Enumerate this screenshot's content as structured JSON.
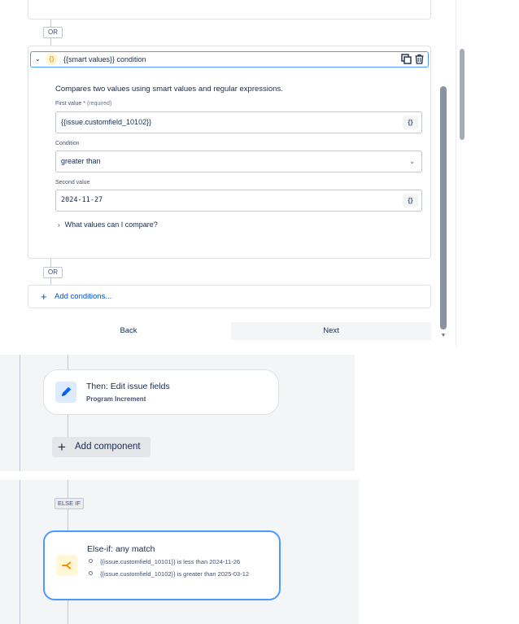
{
  "condition_panel": {
    "or_label": "OR",
    "condition": {
      "title": "{{smart values}} condition",
      "smart_icon": "{}",
      "description": "Compares two values using smart values and regular expressions.",
      "first_value": {
        "label": "First value",
        "required_marker": "*",
        "required_text": "(required)",
        "value": "{{issue.customfield_10102}}",
        "brace_button": "{}"
      },
      "condition_field": {
        "label": "Condition",
        "value": "greater than"
      },
      "second_value": {
        "label": "Second value",
        "value": "2024-11-27",
        "brace_button": "{}"
      },
      "expand_link": "What values can I compare?"
    },
    "add_conditions": "Add conditions...",
    "back": "Back",
    "next": "Next"
  },
  "then_panel": {
    "card_title": "Then: Edit issue fields",
    "card_subtitle": "Program Increment",
    "add_component": "Add component"
  },
  "else_panel": {
    "badge": "ELSE IF",
    "card_title": "Else-if: any match",
    "conditions": [
      "{{issue.customfield_10101}} is less than 2024-11-26",
      "{{issue.customfield_10102}} is greater than 2025-03-12"
    ]
  },
  "colors": {
    "accent": "#0052cc",
    "focus_border": "#4c9aff",
    "smart_orange": "#ff991f",
    "edit_blue": "#0065ff"
  }
}
